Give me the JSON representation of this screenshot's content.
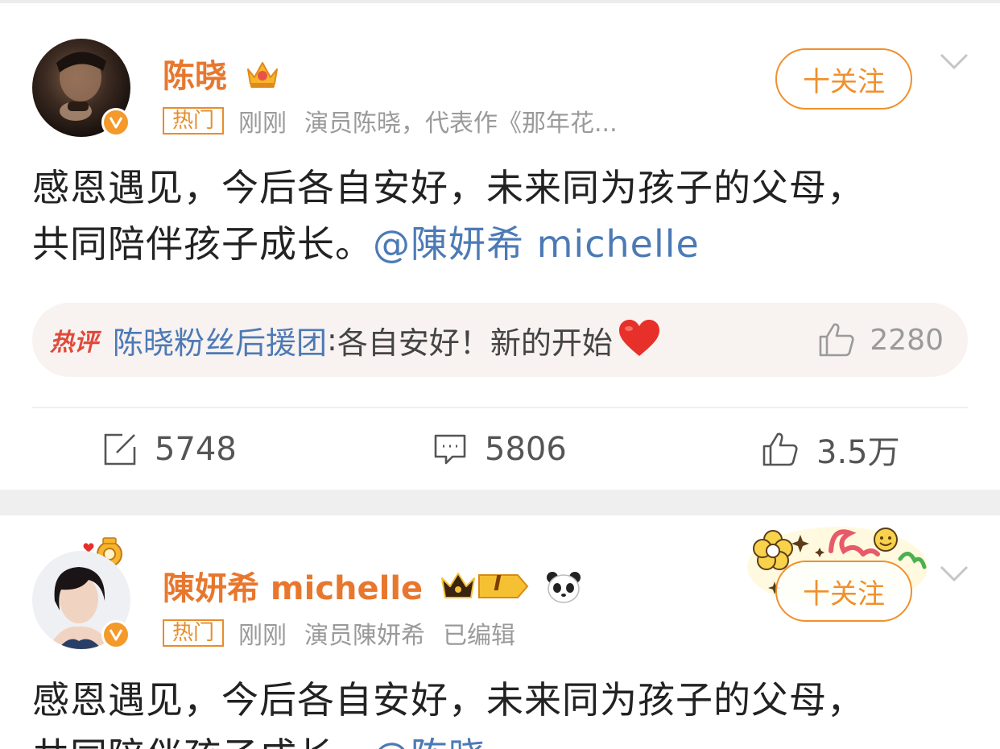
{
  "posts": [
    {
      "username": "陈晓",
      "hot_tag": "热门",
      "time": "刚刚",
      "source": "演员陈晓，代表作《那年花...",
      "follow_label": "十关注",
      "text_line1": "感恩遇见，今后各自安好，未来同为孩子的父母，",
      "text_line2": "共同陪伴孩子成长。",
      "mention": "@陳妍希 michelle",
      "hot_comment": {
        "label": "热评",
        "user": "陈晓粉丝后援团",
        "separator": ": ",
        "text": "各自安好！新的开始",
        "likes": "2280"
      },
      "reposts": "5748",
      "comments": "5806",
      "likes": "3.5万"
    },
    {
      "username": "陳妍希 michelle",
      "level_badge": "I",
      "hot_tag": "热门",
      "time": "刚刚",
      "source": "演员陳妍希",
      "edited": "已编辑",
      "follow_label": "十关注",
      "text_line1": "感恩遇见，今后各自安好，未来同为孩子的父母，",
      "text_line2": "共同陪伴孩子成长。",
      "mention": "@陈晓"
    }
  ],
  "colors": {
    "username": "#e8772e",
    "accent": "#f0902c",
    "mention": "#4c7ab5",
    "hot_label": "#e04a3a",
    "meta": "#9a9a9a"
  },
  "icons": [
    "verified-badge-icon",
    "crown-icon",
    "chevron-down-icon",
    "thumbs-up-icon",
    "repost-icon",
    "comment-icon",
    "heart-emoji-icon",
    "panda-icon"
  ]
}
